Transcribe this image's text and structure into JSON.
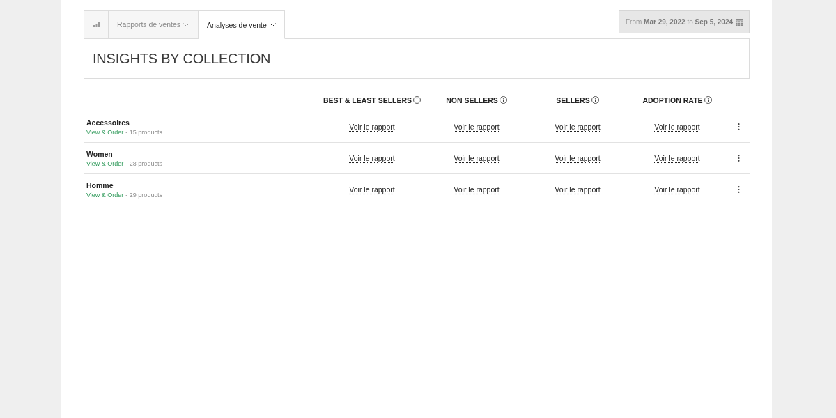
{
  "tabs": [
    {
      "kind": "icon",
      "selected": false
    },
    {
      "kind": "menu",
      "label": "Rapports de ventes",
      "selected": false
    },
    {
      "kind": "menu",
      "label": "Analyses de vente",
      "selected": true
    }
  ],
  "date_range": "From **Mar 29, 2022** to **Sep 5, 2024**",
  "panel": {
    "title": "INSIGHTS BY COLLECTION"
  },
  "table": {
    "columns": [
      "BEST & LEAST SELLERS",
      "NON SELLERS",
      "SELLERS",
      "ADOPTION RATE"
    ],
    "rows": [
      {
        "name": "Accessoires",
        "link": "View & Order",
        "count": "- 15 products",
        "cells": [
          "Voir le rapport",
          "Voir le rapport",
          "Voir le rapport",
          "Voir le rapport"
        ]
      },
      {
        "name": "Women",
        "link": "View & Order",
        "count": "- 28 products",
        "cells": [
          "Voir le rapport",
          "Voir le rapport",
          "Voir le rapport",
          "Voir le rapport"
        ]
      },
      {
        "name": "Homme",
        "link": "View & Order",
        "count": "- 29 products",
        "cells": [
          "Voir le rapport",
          "Voir le rapport",
          "Voir le rapport",
          "Voir le rapport"
        ]
      }
    ]
  }
}
